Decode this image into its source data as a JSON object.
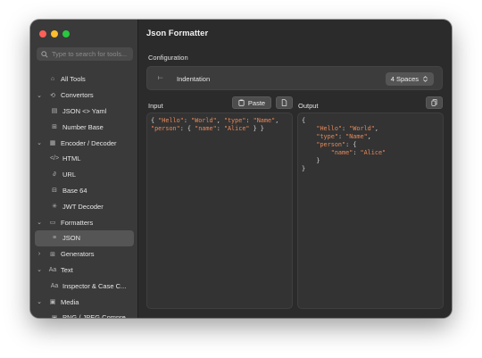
{
  "window": {
    "title": "Json Formatter"
  },
  "sidebar": {
    "search_placeholder": "Type to search for tools...",
    "items": [
      {
        "label": "All Tools",
        "icon": "home-icon",
        "glyph": "⌂",
        "level": 0,
        "chevron": ""
      },
      {
        "label": "Convertors",
        "icon": "convert-icon",
        "glyph": "⟲",
        "level": 0,
        "chevron": "⌄"
      },
      {
        "label": "JSON <> Yaml",
        "icon": "document-icon",
        "glyph": "▤",
        "level": 1,
        "chevron": ""
      },
      {
        "label": "Number Base",
        "icon": "number-icon",
        "glyph": "⊞",
        "level": 1,
        "chevron": ""
      },
      {
        "label": "Encoder / Decoder",
        "icon": "grid-icon",
        "glyph": "▦",
        "level": 0,
        "chevron": "⌄"
      },
      {
        "label": "HTML",
        "icon": "code-icon",
        "glyph": "</>",
        "level": 1,
        "chevron": ""
      },
      {
        "label": "URL",
        "icon": "link-icon",
        "glyph": "∂",
        "level": 1,
        "chevron": ""
      },
      {
        "label": "Base 64",
        "icon": "base64-icon",
        "glyph": "⊟",
        "level": 1,
        "chevron": ""
      },
      {
        "label": "JWT Decoder",
        "icon": "jwt-icon",
        "glyph": "✳",
        "level": 1,
        "chevron": ""
      },
      {
        "label": "Formatters",
        "icon": "folder-icon",
        "glyph": "▭",
        "level": 0,
        "chevron": "⌄"
      },
      {
        "label": "JSON",
        "icon": "lines-icon",
        "glyph": "≡",
        "level": 1,
        "chevron": "",
        "selected": true
      },
      {
        "label": "Generators",
        "icon": "generator-icon",
        "glyph": "⊞",
        "level": 0,
        "chevron": "›"
      },
      {
        "label": "Text",
        "icon": "text-icon",
        "glyph": "Aa",
        "level": 0,
        "chevron": "⌄"
      },
      {
        "label": "Inspector & Case C...",
        "icon": "text-case-icon",
        "glyph": "Aa",
        "level": 1,
        "chevron": ""
      },
      {
        "label": "Media",
        "icon": "media-icon",
        "glyph": "▣",
        "level": 0,
        "chevron": "⌄"
      },
      {
        "label": "PNG / JPEG Compre...",
        "icon": "image-icon",
        "glyph": "▣",
        "level": 1,
        "chevron": ""
      }
    ]
  },
  "main": {
    "configuration_label": "Configuration",
    "indentation_label": "Indentation",
    "indentation_value": "4 Spaces",
    "input_label": "Input",
    "paste_label": "Paste",
    "output_label": "Output",
    "input_lines": [
      "{ \"Hello\": \"World\", \"type\": \"Name\",",
      "\"person\": { \"name\": \"Alice\" } }"
    ],
    "output_lines": [
      "{",
      "    \"Hello\": \"World\",",
      "    \"type\": \"Name\",",
      "    \"person\": {",
      "        \"name\": \"Alice\"",
      "    }",
      "}"
    ]
  },
  "colors": {
    "accent_key": "#e8895a",
    "red": "#ff5f57",
    "yellow": "#febc2e",
    "green": "#28c840"
  }
}
